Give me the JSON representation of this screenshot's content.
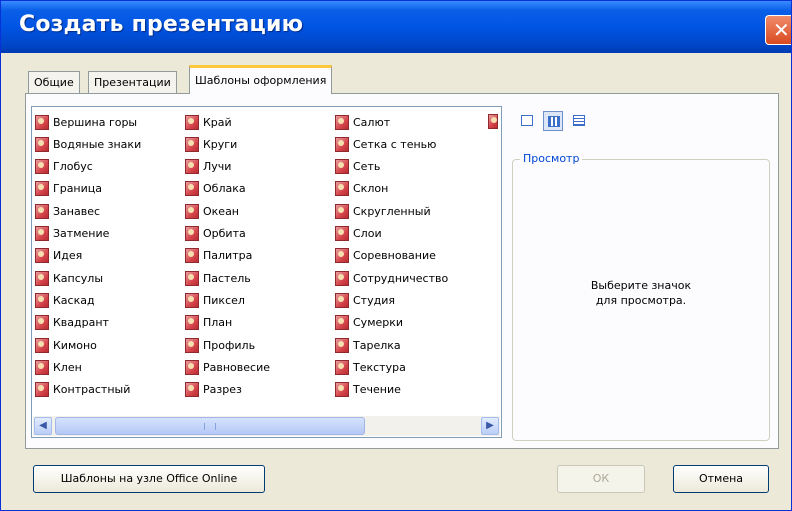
{
  "window": {
    "title": "Создать презентацию"
  },
  "tabs": [
    "Общие",
    "Презентации",
    "Шаблоны оформления"
  ],
  "templates": {
    "columns": [
      [
        "Вершина горы",
        "Водяные знаки",
        "Глобус",
        "Граница",
        "Занавес",
        "Затмение",
        "Идея",
        "Капсулы",
        "Каскад",
        "Квадрант",
        "Кимоно",
        "Клен",
        "Контрастный"
      ],
      [
        "Край",
        "Круги",
        "Лучи",
        "Облака",
        "Океан",
        "Орбита",
        "Палитра",
        "Пастель",
        "Пиксел",
        "План",
        "Профиль",
        "Равновесие",
        "Разрез"
      ],
      [
        "Салют",
        "Сетка с тенью",
        "Сеть",
        "Склон",
        "Скругленный",
        "Слои",
        "Соревнование",
        "Сотрудничество",
        "Студия",
        "Сумерки",
        "Тарелка",
        "Текстура",
        "Течение"
      ]
    ],
    "partial_icon_count": 5,
    "icon": "powerpoint-template-icon",
    "selected_view": "small-icons-view"
  },
  "view_buttons": [
    "large-icons-view",
    "small-icons-view",
    "details-view"
  ],
  "preview": {
    "label": "Просмотр",
    "message_line1": "Выберите значок",
    "message_line2": "для просмотра."
  },
  "buttons": {
    "office_online": "Шаблоны на узле Office Online",
    "ok": "ОК",
    "cancel": "Отмена"
  },
  "colors": {
    "titlebar": "#0054e3",
    "dialog": "#ece9d8",
    "active_tab_accent": "#ffc83c",
    "preview_label": "#0046d5"
  }
}
